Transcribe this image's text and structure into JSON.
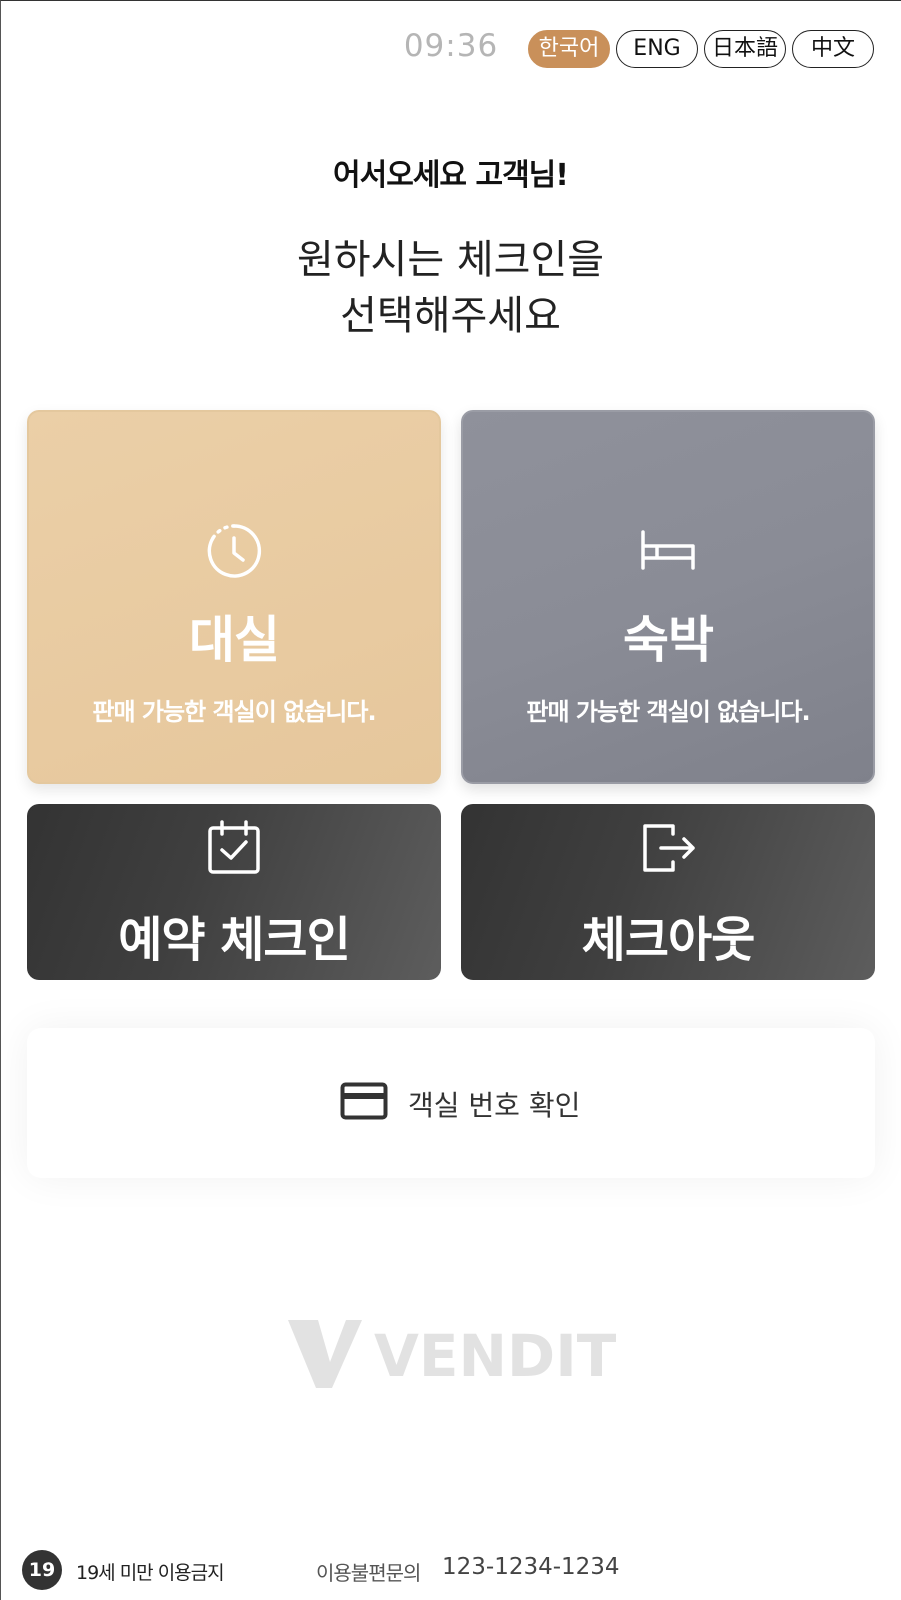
{
  "header": {
    "time": "09:36",
    "languages": [
      {
        "label": "한국어",
        "active": true
      },
      {
        "label": "ENG",
        "active": false
      },
      {
        "label": "日本語",
        "active": false
      },
      {
        "label": "中文",
        "active": false
      }
    ]
  },
  "greeting": "어서오세요 고객님!",
  "instruction": {
    "line1": "원하시는 체크인을",
    "line2": "선택해주세요"
  },
  "tiles": {
    "daesil": {
      "title": "대실",
      "subtitle": "판매 가능한 객실이 없습니다.",
      "icon": "clock-history-icon",
      "color": "#e6c79c"
    },
    "sukbak": {
      "title": "숙박",
      "subtitle": "판매 가능한 객실이 없습니다.",
      "icon": "bed-icon",
      "color": "#8b8d97"
    },
    "reservation": {
      "title": "예약 체크인",
      "icon": "calendar-check-icon",
      "color": "#3a3a3a"
    },
    "checkout": {
      "title": "체크아웃",
      "icon": "exit-door-icon",
      "color": "#3a3a3a"
    }
  },
  "room_check": {
    "label": "객실 번호 확인",
    "icon": "card-icon"
  },
  "brand": {
    "logo_text": "VENDIT"
  },
  "footer": {
    "age_badge": "19",
    "age_notice": "19세 미만 이용금지",
    "contact_label": "이용불편문의",
    "contact_phone": "123-1234-1234"
  },
  "colors": {
    "accent": "#c9905a",
    "dark_tile": "#3a3a3a"
  }
}
